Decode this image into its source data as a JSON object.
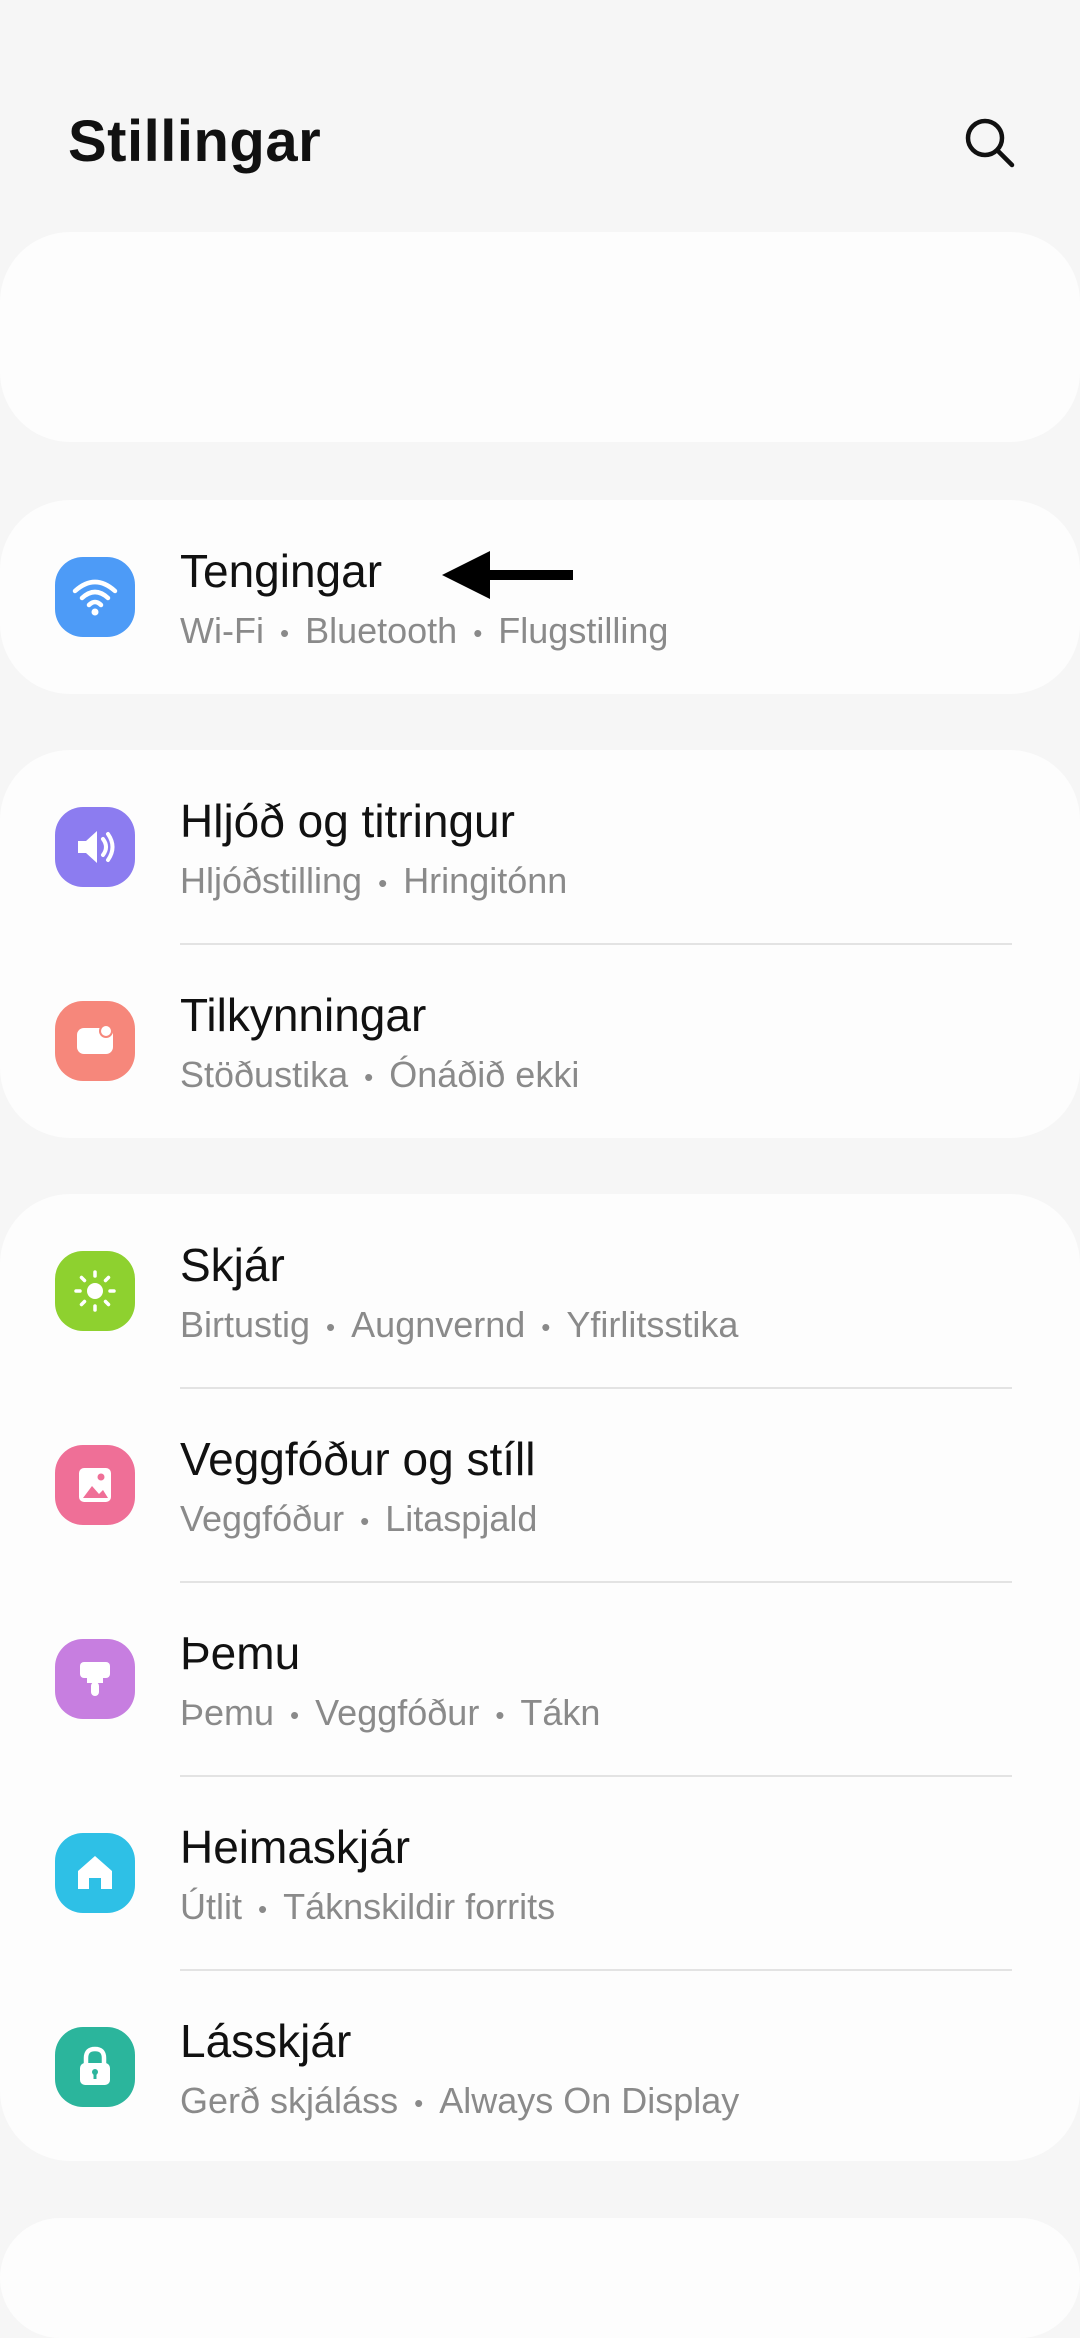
{
  "header": {
    "title": "Stillingar",
    "search_icon": "search-icon"
  },
  "items": [
    {
      "title": "Tengingar",
      "subs": [
        "Wi-Fi",
        "Bluetooth",
        "Flugstilling"
      ],
      "icon": "wifi-icon",
      "color": "#4d9bf7"
    },
    {
      "title": "Hljóð og titringur",
      "subs": [
        "Hljóðstilling",
        "Hringitónn"
      ],
      "icon": "speaker-icon",
      "color": "#8c7cf0"
    },
    {
      "title": "Tilkynningar",
      "subs": [
        "Stöðustika",
        "Ónáðið ekki"
      ],
      "icon": "notification-icon",
      "color": "#f6877b"
    },
    {
      "title": "Skjár",
      "subs": [
        "Birtustig",
        "Augnvernd",
        "Yfirlitsstika"
      ],
      "icon": "sun-icon",
      "color": "#8ed12f"
    },
    {
      "title": "Veggfóður og stíll",
      "subs": [
        "Veggfóður",
        "Litaspjald"
      ],
      "icon": "image-icon",
      "color": "#ef6f97"
    },
    {
      "title": "Þemu",
      "subs": [
        "Þemu",
        "Veggfóður",
        "Tákn"
      ],
      "icon": "brush-icon",
      "color": "#c77ee0"
    },
    {
      "title": "Heimaskjár",
      "subs": [
        "Útlit",
        "Táknskildir forrits"
      ],
      "icon": "home-icon",
      "color": "#2ec0e6"
    },
    {
      "title": "Lásskjár",
      "subs": [
        "Gerð skjáláss",
        "Always On Display"
      ],
      "icon": "lock-icon",
      "color": "#2bb59c"
    }
  ]
}
